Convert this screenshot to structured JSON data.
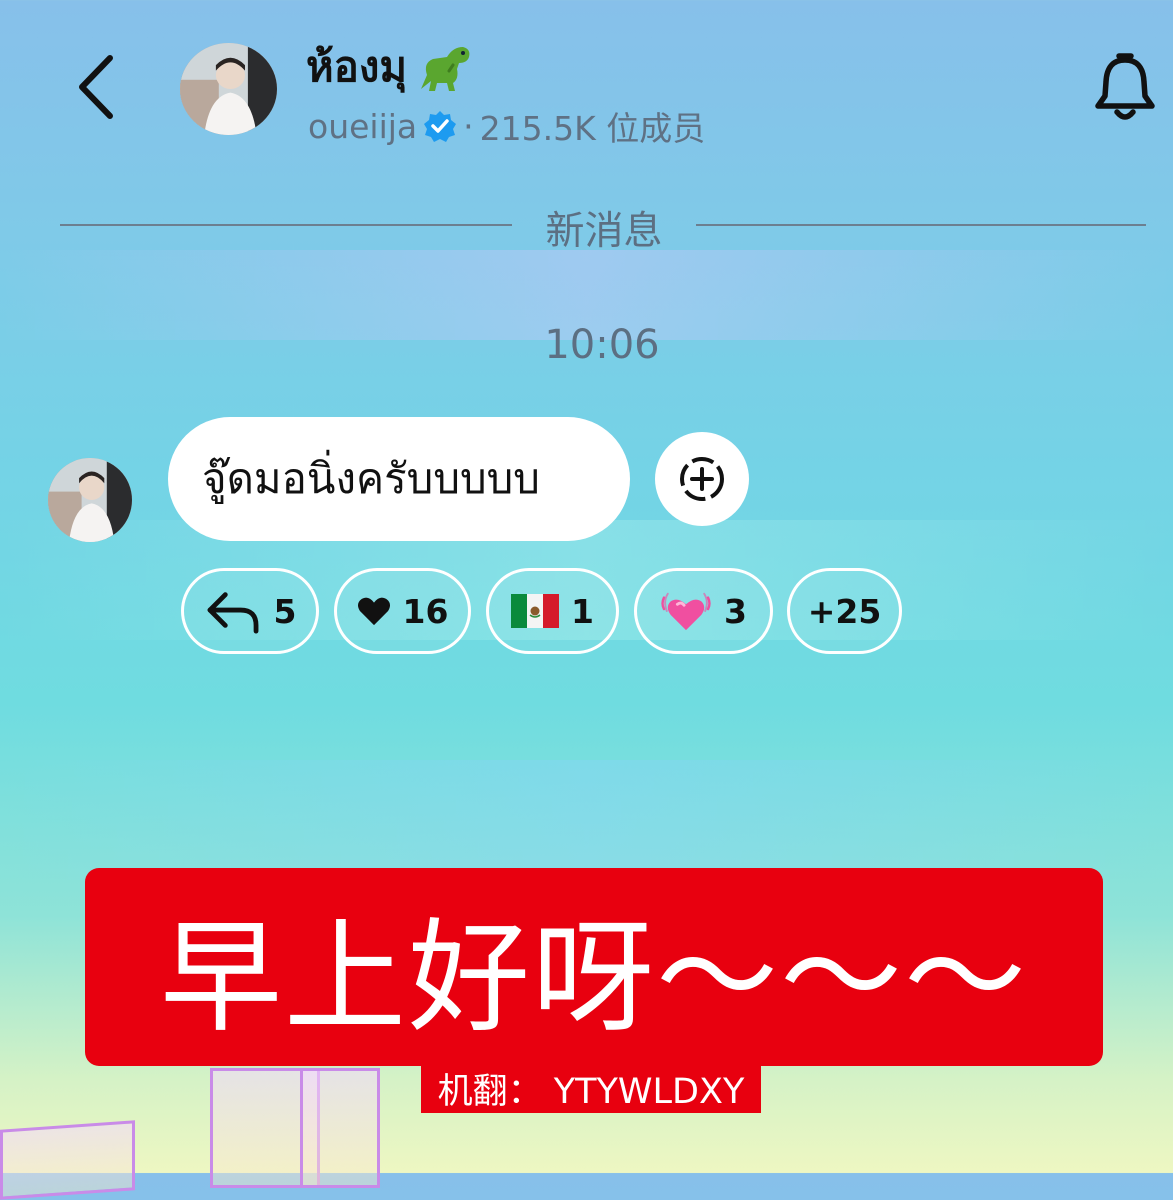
{
  "header": {
    "room_name": "ห้องมุ",
    "room_emoji": "dinosaur-icon",
    "owner": "oueiija",
    "verified_icon": "verified-badge-icon",
    "separator": "·",
    "members": "215.5K 位成员",
    "back_icon": "chevron-left-icon",
    "bell_icon": "bell-icon"
  },
  "divider": {
    "label": "新消息"
  },
  "timestamp": "10:06",
  "message": {
    "text": "จู๊ดมอนิ่งครับบบบบ",
    "add_reaction_icon": "add-reaction-icon"
  },
  "reactions": [
    {
      "icon": "reply-arrow-icon",
      "count": "5"
    },
    {
      "icon": "black-heart-icon",
      "count": "16"
    },
    {
      "icon": "mexico-flag-icon",
      "count": "1"
    },
    {
      "icon": "beating-heart-icon",
      "count": "3"
    },
    {
      "icon": "",
      "count": "+25"
    }
  ],
  "overlay": {
    "caption": "早上好呀～～～",
    "credit": "机翻： YTYWLDXY"
  },
  "colors": {
    "caption_bg": "#e8000f",
    "text_primary": "#111111",
    "text_secondary": "#5f7184",
    "verified_blue": "#1d9bf0"
  }
}
